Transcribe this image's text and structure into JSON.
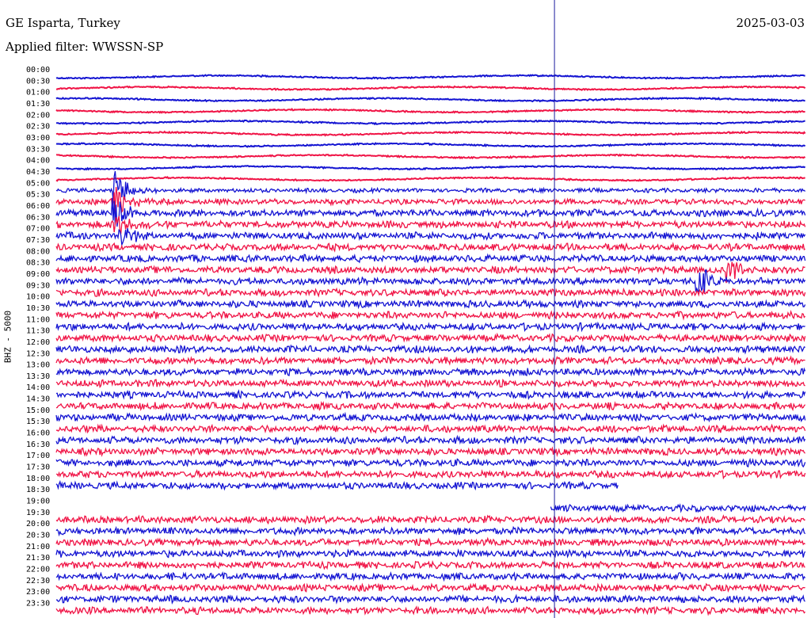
{
  "header": {
    "station": "GE Isparta, Turkey",
    "date": "2025-03-03",
    "filter": "Applied filter: WWSSN-SP"
  },
  "chart_data": {
    "type": "line",
    "title": "GE Isparta, Turkey",
    "ylabel": "BHZ - 5000",
    "colors": [
      "#1414d2",
      "#f01446"
    ],
    "marker_color": "#1a1a9e",
    "rows": [
      {
        "label": "00:00",
        "color": "blue",
        "amplitude": 1,
        "start": 0,
        "end": 1
      },
      {
        "label": "00:30",
        "color": "red",
        "amplitude": 1,
        "start": 0,
        "end": 1
      },
      {
        "label": "01:00",
        "color": "blue",
        "amplitude": 1,
        "start": 0,
        "end": 1
      },
      {
        "label": "01:30",
        "color": "red",
        "amplitude": 1,
        "start": 0,
        "end": 1
      },
      {
        "label": "02:00",
        "color": "blue",
        "amplitude": 1,
        "start": 0,
        "end": 1
      },
      {
        "label": "02:30",
        "color": "red",
        "amplitude": 1,
        "start": 0,
        "end": 1
      },
      {
        "label": "03:00",
        "color": "blue",
        "amplitude": 1,
        "start": 0,
        "end": 1
      },
      {
        "label": "03:30",
        "color": "red",
        "amplitude": 1,
        "start": 0,
        "end": 1
      },
      {
        "label": "04:00",
        "color": "blue",
        "amplitude": 1,
        "start": 0,
        "end": 1
      },
      {
        "label": "04:30",
        "color": "red",
        "amplitude": 1,
        "start": 0,
        "end": 1
      },
      {
        "label": "05:00",
        "color": "blue",
        "amplitude": 3,
        "start": 0,
        "end": 1
      },
      {
        "label": "05:30",
        "color": "red",
        "amplitude": 4,
        "start": 0,
        "end": 1
      },
      {
        "label": "06:00",
        "color": "blue",
        "amplitude": 5,
        "start": 0,
        "end": 1
      },
      {
        "label": "06:30",
        "color": "red",
        "amplitude": 5,
        "start": 0,
        "end": 1
      },
      {
        "label": "07:00",
        "color": "blue",
        "amplitude": 5,
        "start": 0,
        "end": 1
      },
      {
        "label": "07:30",
        "color": "red",
        "amplitude": 5,
        "start": 0,
        "end": 1
      },
      {
        "label": "08:00",
        "color": "blue",
        "amplitude": 5,
        "start": 0,
        "end": 1
      },
      {
        "label": "08:30",
        "color": "red",
        "amplitude": 5,
        "start": 0,
        "end": 1
      },
      {
        "label": "09:00",
        "color": "blue",
        "amplitude": 5,
        "start": 0,
        "end": 1
      },
      {
        "label": "09:30",
        "color": "red",
        "amplitude": 5,
        "start": 0,
        "end": 1
      },
      {
        "label": "10:00",
        "color": "blue",
        "amplitude": 5,
        "start": 0,
        "end": 1
      },
      {
        "label": "10:30",
        "color": "red",
        "amplitude": 5,
        "start": 0,
        "end": 1
      },
      {
        "label": "11:00",
        "color": "blue",
        "amplitude": 5,
        "start": 0,
        "end": 1
      },
      {
        "label": "11:30",
        "color": "red",
        "amplitude": 5,
        "start": 0,
        "end": 1
      },
      {
        "label": "12:00",
        "color": "blue",
        "amplitude": 5,
        "start": 0,
        "end": 1
      },
      {
        "label": "12:30",
        "color": "red",
        "amplitude": 5,
        "start": 0,
        "end": 1
      },
      {
        "label": "13:00",
        "color": "blue",
        "amplitude": 5,
        "start": 0,
        "end": 1
      },
      {
        "label": "13:30",
        "color": "red",
        "amplitude": 5,
        "start": 0,
        "end": 1
      },
      {
        "label": "14:00",
        "color": "blue",
        "amplitude": 5,
        "start": 0,
        "end": 1
      },
      {
        "label": "14:30",
        "color": "red",
        "amplitude": 5,
        "start": 0,
        "end": 1
      },
      {
        "label": "15:00",
        "color": "blue",
        "amplitude": 5,
        "start": 0,
        "end": 1
      },
      {
        "label": "15:30",
        "color": "red",
        "amplitude": 5,
        "start": 0,
        "end": 1
      },
      {
        "label": "16:00",
        "color": "blue",
        "amplitude": 5,
        "start": 0,
        "end": 1
      },
      {
        "label": "16:30",
        "color": "red",
        "amplitude": 5,
        "start": 0,
        "end": 1
      },
      {
        "label": "17:00",
        "color": "blue",
        "amplitude": 5,
        "start": 0,
        "end": 1
      },
      {
        "label": "17:30",
        "color": "red",
        "amplitude": 5,
        "start": 0,
        "end": 1
      },
      {
        "label": "18:00",
        "color": "blue",
        "amplitude": 5,
        "start": 0,
        "end": 0.75
      },
      {
        "label": "18:30",
        "color": "red",
        "amplitude": 0,
        "start": 0,
        "end": 0
      },
      {
        "label": "19:00",
        "color": "blue",
        "amplitude": 5,
        "start": 0.66,
        "end": 1
      },
      {
        "label": "19:30",
        "color": "red",
        "amplitude": 5,
        "start": 0,
        "end": 1
      },
      {
        "label": "20:00",
        "color": "blue",
        "amplitude": 5,
        "start": 0,
        "end": 1
      },
      {
        "label": "20:30",
        "color": "red",
        "amplitude": 5,
        "start": 0,
        "end": 1
      },
      {
        "label": "21:00",
        "color": "blue",
        "amplitude": 5,
        "start": 0,
        "end": 1
      },
      {
        "label": "21:30",
        "color": "red",
        "amplitude": 5,
        "start": 0,
        "end": 1
      },
      {
        "label": "22:00",
        "color": "blue",
        "amplitude": 5,
        "start": 0,
        "end": 1
      },
      {
        "label": "22:30",
        "color": "red",
        "amplitude": 5,
        "start": 0,
        "end": 1
      },
      {
        "label": "23:00",
        "color": "blue",
        "amplitude": 5,
        "start": 0,
        "end": 1
      },
      {
        "label": "23:30",
        "color": "red",
        "amplitude": 5,
        "start": 0,
        "end": 1
      }
    ],
    "events": [
      {
        "row": "05:00",
        "x": 0.08,
        "amplitude": 25
      },
      {
        "row": "05:30",
        "x": 0.08,
        "amplitude": 22
      },
      {
        "row": "06:00",
        "x": 0.08,
        "amplitude": 20
      },
      {
        "row": "06:30",
        "x": 0.08,
        "amplitude": 16
      },
      {
        "row": "07:00",
        "x": 0.09,
        "amplitude": 12
      },
      {
        "row": "09:00",
        "x": 0.86,
        "amplitude": 18
      },
      {
        "row": "08:30",
        "x": 0.9,
        "amplitude": 16
      }
    ],
    "marker_x": 0.665
  }
}
